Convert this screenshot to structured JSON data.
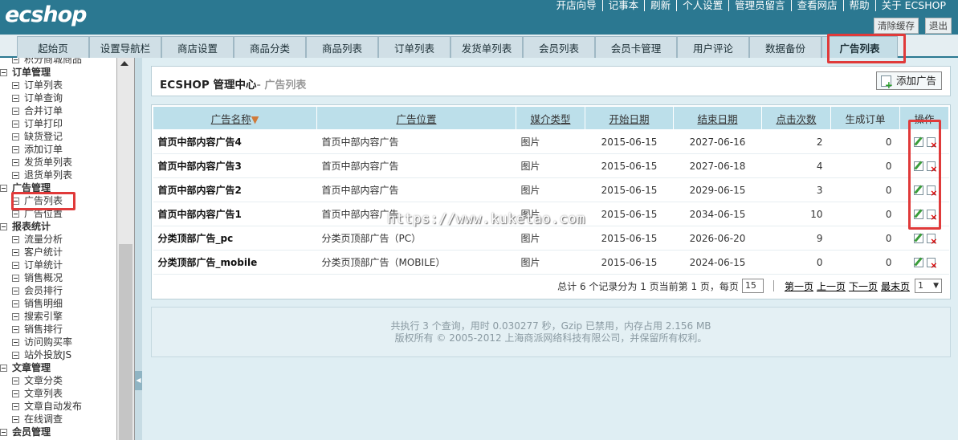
{
  "header": {
    "logo": "ecshop",
    "nav": [
      "开店向导",
      "记事本",
      "刷新",
      "个人设置",
      "管理员留言",
      "查看网店",
      "帮助",
      "关于 ECSHOP"
    ],
    "buttons": {
      "clear_cache": "清除缓存",
      "logout": "退出"
    }
  },
  "tabs": [
    "起始页",
    "设置导航栏",
    "商店设置",
    "商品分类",
    "商品列表",
    "订单列表",
    "发货单列表",
    "会员列表",
    "会员卡管理",
    "用户评论",
    "数据备份",
    "广告列表"
  ],
  "sidebar": {
    "items": [
      {
        "type": "item",
        "label": "积分商城商品"
      },
      {
        "type": "group",
        "label": "订单管理"
      },
      {
        "type": "item",
        "label": "订单列表"
      },
      {
        "type": "item",
        "label": "订单查询"
      },
      {
        "type": "item",
        "label": "合并订单"
      },
      {
        "type": "item",
        "label": "订单打印"
      },
      {
        "type": "item",
        "label": "缺货登记"
      },
      {
        "type": "item",
        "label": "添加订单"
      },
      {
        "type": "item",
        "label": "发货单列表"
      },
      {
        "type": "item",
        "label": "退货单列表"
      },
      {
        "type": "group",
        "label": "广告管理"
      },
      {
        "type": "item",
        "label": "广告列表"
      },
      {
        "type": "item",
        "label": "广告位置"
      },
      {
        "type": "group",
        "label": "报表统计"
      },
      {
        "type": "item",
        "label": "流量分析"
      },
      {
        "type": "item",
        "label": "客户统计"
      },
      {
        "type": "item",
        "label": "订单统计"
      },
      {
        "type": "item",
        "label": "销售概况"
      },
      {
        "type": "item",
        "label": "会员排行"
      },
      {
        "type": "item",
        "label": "销售明细"
      },
      {
        "type": "item",
        "label": "搜索引擎"
      },
      {
        "type": "item",
        "label": "销售排行"
      },
      {
        "type": "item",
        "label": "访问购买率"
      },
      {
        "type": "item",
        "label": "站外投放JS"
      },
      {
        "type": "group",
        "label": "文章管理"
      },
      {
        "type": "item",
        "label": "文章分类"
      },
      {
        "type": "item",
        "label": "文章列表"
      },
      {
        "type": "item",
        "label": "文章自动发布"
      },
      {
        "type": "item",
        "label": "在线调查"
      },
      {
        "type": "group",
        "label": "会员管理"
      }
    ]
  },
  "page": {
    "title": "ECSHOP 管理中心",
    "subtitle": "- 广告列表",
    "add_button": "添加广告"
  },
  "table": {
    "headers": [
      "广告名称",
      "广告位置",
      "媒介类型",
      "开始日期",
      "结束日期",
      "点击次数",
      "生成订单",
      "操作"
    ],
    "sort_indicator": "▼",
    "rows": [
      [
        "首页中部内容广告4",
        "首页中部内容广告",
        "图片",
        "2015-06-15",
        "2027-06-16",
        "2",
        "0"
      ],
      [
        "首页中部内容广告3",
        "首页中部内容广告",
        "图片",
        "2015-06-15",
        "2027-06-18",
        "4",
        "0"
      ],
      [
        "首页中部内容广告2",
        "首页中部内容广告",
        "图片",
        "2015-06-15",
        "2029-06-15",
        "3",
        "0"
      ],
      [
        "首页中部内容广告1",
        "首页中部内容广告",
        "图片",
        "2015-06-15",
        "2034-06-15",
        "10",
        "0"
      ],
      [
        "分类顶部广告_pc",
        "分类页顶部广告（PC）",
        "图片",
        "2015-06-15",
        "2026-06-20",
        "9",
        "0"
      ],
      [
        "分类顶部广告_mobile",
        "分类页顶部广告（MOBILE）",
        "图片",
        "2015-06-15",
        "2024-06-15",
        "0",
        "0"
      ]
    ]
  },
  "pager": {
    "summary": "总计 6 个记录分为 1 页当前第 1 页，每页",
    "per_page": "15",
    "first": "第一页",
    "prev": "上一页",
    "next": "下一页",
    "last": "最末页",
    "page": "1"
  },
  "footer": {
    "line1": "共执行 3 个查询，用时 0.030277 秒，Gzip 已禁用，内存占用 2.156 MB",
    "line2": "版权所有 © 2005-2012 上海商派网络科技有限公司，并保留所有权利。"
  },
  "watermark": "https://www.kuketao.com",
  "colors": {
    "header": "#2b7891",
    "table_header": "#bcdfea",
    "highlight": "#e03a3a"
  }
}
